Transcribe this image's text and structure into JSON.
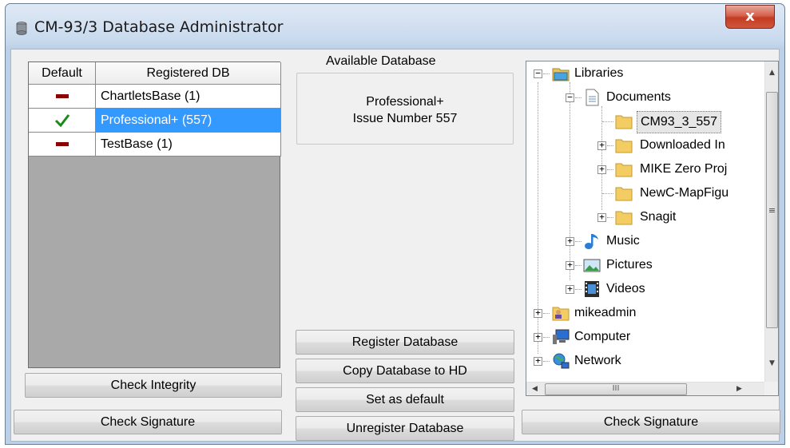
{
  "window": {
    "title": "CM-93/3 Database Administrator",
    "close_label": "x"
  },
  "registered_table": {
    "headers": [
      "Default",
      "Registered DB"
    ],
    "rows": [
      {
        "default": "dash",
        "name": "ChartletsBase (1)",
        "selected": false
      },
      {
        "default": "check",
        "name": "Professional+ (557)",
        "selected": true
      },
      {
        "default": "dash",
        "name": "TestBase (1)",
        "selected": false
      }
    ]
  },
  "left_buttons": {
    "check_integrity": "Check Integrity",
    "check_signature": "Check Signature"
  },
  "available_database": {
    "label": "Available Database",
    "line1": "Professional+",
    "line2": "Issue Number 557"
  },
  "middle_buttons": {
    "register": "Register Database",
    "copy": "Copy Database to HD",
    "set_default": "Set as default",
    "unregister": "Unregister Database"
  },
  "tree": {
    "nodes": [
      {
        "label": "Libraries",
        "icon": "libraries-icon"
      },
      {
        "label": "Documents",
        "icon": "documents-icon"
      },
      {
        "label": "CM93_3_557",
        "icon": "folder-icon"
      },
      {
        "label": "Downloaded In",
        "icon": "folder-icon"
      },
      {
        "label": "MIKE Zero Proj",
        "icon": "folder-icon"
      },
      {
        "label": "NewC-MapFigu",
        "icon": "folder-icon"
      },
      {
        "label": "Snagit",
        "icon": "folder-icon"
      },
      {
        "label": "Music",
        "icon": "music-icon"
      },
      {
        "label": "Pictures",
        "icon": "pictures-icon"
      },
      {
        "label": "Videos",
        "icon": "videos-icon"
      },
      {
        "label": "mikeadmin",
        "icon": "user-folder-icon"
      },
      {
        "label": "Computer",
        "icon": "computer-icon"
      },
      {
        "label": "Network",
        "icon": "network-icon"
      }
    ],
    "hscroll_grip": "III"
  },
  "right_buttons": {
    "check_signature": "Check Signature"
  },
  "colors": {
    "selection": "#3399ff",
    "dash": "#8b0000",
    "check": "#1a8a1a"
  }
}
